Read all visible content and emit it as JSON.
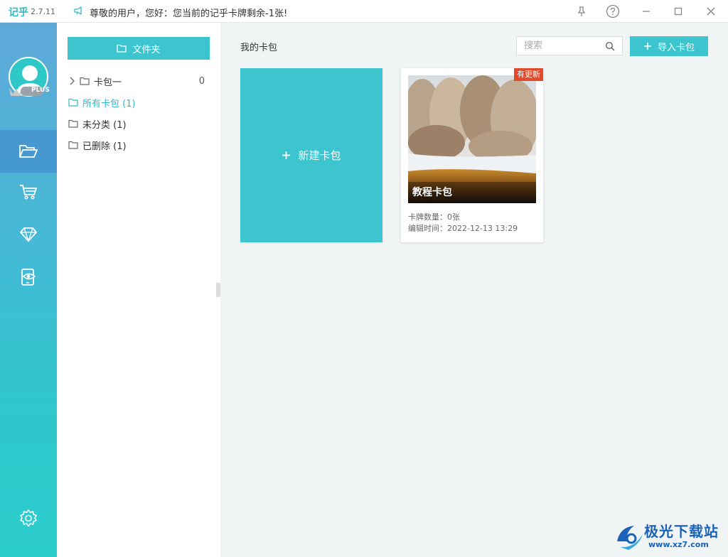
{
  "titlebar": {
    "app_name": "记乎",
    "version": "2.7.11",
    "notice": "尊敬的用户，您好：您当前的记乎卡牌剩余-1张!",
    "buttons": [
      "pin-icon",
      "help-icon",
      "minimize-icon",
      "maximize-icon",
      "close-icon"
    ]
  },
  "rail": {
    "badge": "PLUS",
    "items": [
      {
        "icon": "folder-open-icon",
        "active": true
      },
      {
        "icon": "shopping-cart-icon",
        "active": false
      },
      {
        "icon": "diamond-icon",
        "active": false
      },
      {
        "icon": "eye-icon",
        "active": false
      },
      {
        "icon": "gear-icon",
        "active": false
      }
    ]
  },
  "folders": {
    "button_label": "文件夹",
    "items": [
      {
        "label": "卡包一",
        "count": "0",
        "expandable": true,
        "selected": false
      },
      {
        "label": "所有卡包 (1)",
        "selected": true
      },
      {
        "label": "未分类 (1)",
        "selected": false
      },
      {
        "label": "已删除 (1)",
        "selected": false
      }
    ]
  },
  "main": {
    "title": "我的卡包",
    "search_placeholder": "搜索",
    "import_label": "导入卡包",
    "new_pack_label": "新建卡包",
    "packs": [
      {
        "name": "教程卡包",
        "badge": "有更新",
        "card_count": "卡牌数量：0张",
        "edit_time": "编辑时间：2022-12-13 13:29"
      }
    ]
  },
  "watermark": {
    "title": "极光下载站",
    "url": "www.xz7.com"
  },
  "colors": {
    "accent": "#3cc4cf",
    "badge": "#e0492a",
    "rail_top": "#5fa8d8",
    "rail_bottom": "#2bcccc",
    "main_bg": "#f0f4f4"
  }
}
